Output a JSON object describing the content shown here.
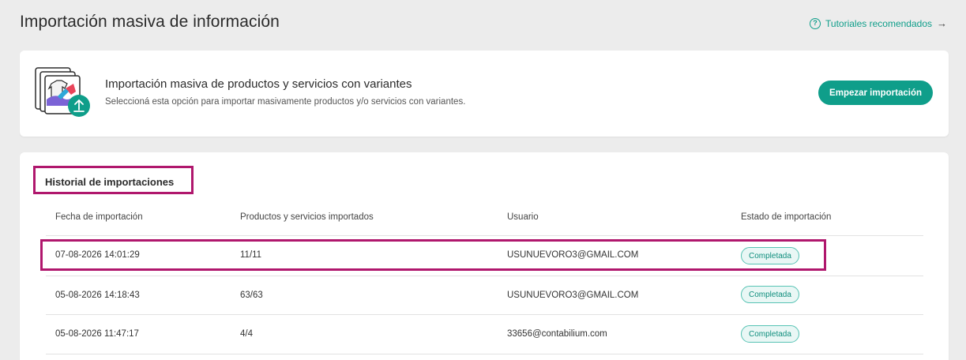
{
  "page": {
    "title": "Importación masiva de información",
    "tutorials_label": "Tutoriales recomendados",
    "tutorials_icon": "question-circle-icon",
    "tutorials_arrow": "→"
  },
  "import_card": {
    "title": "Importación masiva de productos y servicios con variantes",
    "description": "Seleccioná esta opción para importar masivamente productos y/o servicios con variantes.",
    "button_label": "Empezar importación",
    "illustration_icon": "clothing-upload-icon"
  },
  "history": {
    "title": "Historial de importaciones",
    "columns": [
      "Fecha de importación",
      "Productos y servicios importados",
      "Usuario",
      "Estado de importación"
    ],
    "rows": [
      {
        "date": "07-08-2026 14:01:29",
        "count": "11/11",
        "user": "USUNUEVORO3@GMAIL.COM",
        "status": "Completada"
      },
      {
        "date": "05-08-2026 14:18:43",
        "count": "63/63",
        "user": "USUNUEVORO3@GMAIL.COM",
        "status": "Completada"
      },
      {
        "date": "05-08-2026 11:47:17",
        "count": "4/4",
        "user": "33656@contabilium.com",
        "status": "Completada"
      }
    ]
  },
  "colors": {
    "accent": "#0f9e8a",
    "highlight": "#b0176d",
    "background": "#ececec"
  }
}
